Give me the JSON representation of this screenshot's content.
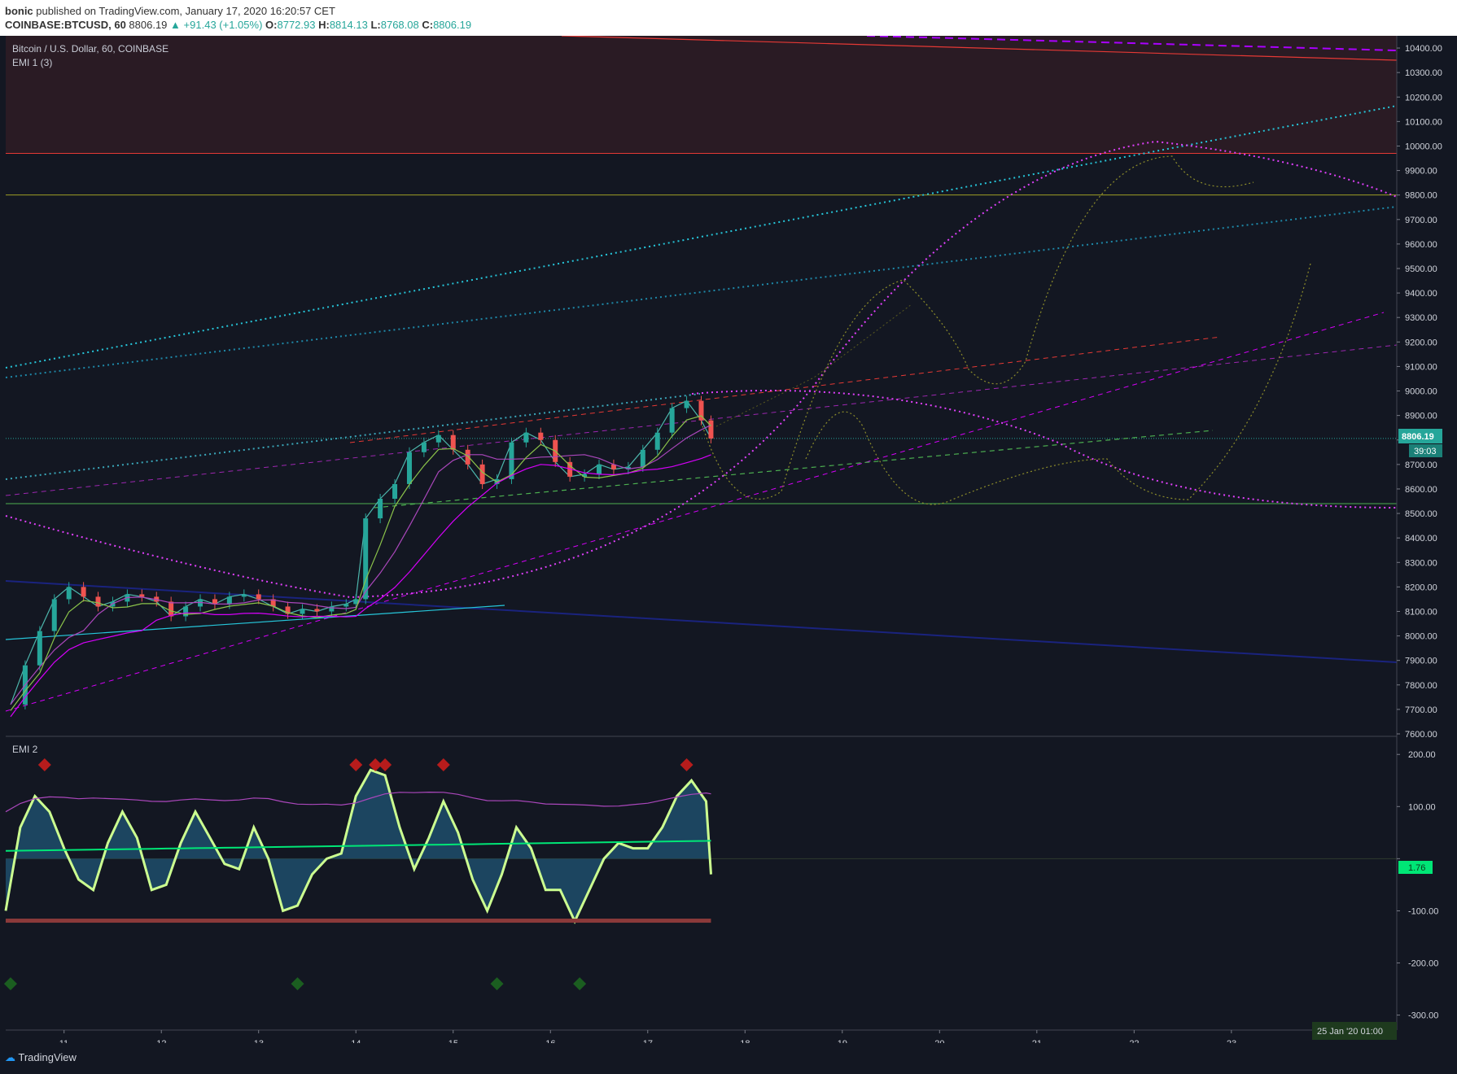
{
  "header": {
    "author": "bonic",
    "published_text": "published on TradingView.com, January 17, 2020 16:20:57 CET",
    "symbol": "COINBASE:BTCUSD, 60",
    "last": "8806.19",
    "change": "+91.43 (+1.05%)",
    "o_label": "O:",
    "o": "8772.93",
    "h_label": "H:",
    "h": "8814.13",
    "l_label": "L:",
    "l": "8768.08",
    "c_label": "C:",
    "c": "8806.19"
  },
  "main_pane": {
    "title": "Bitcoin / U.S. Dollar, 60, COINBASE",
    "indicator": "EMI 1 (3)",
    "price_tag": "8806.19",
    "countdown_tag": "39:03"
  },
  "osc_pane": {
    "title": "EMI 2",
    "value_tag": "1.76"
  },
  "time_axis_tag": "25 Jan '20  01:00",
  "footer": {
    "logo_text": "TradingView"
  },
  "colors": {
    "bg": "#131722",
    "up": "#26a69a",
    "down": "#ef5350",
    "magenta": "#e040fb",
    "cyan": "#26c6da",
    "purple": "#9c27b0",
    "red_line": "#e53935",
    "green_line": "#4caf50",
    "olive": "#8d8d2a"
  },
  "chart_data": [
    {
      "type": "line",
      "title": "Bitcoin / U.S. Dollar, 60, COINBASE",
      "y_ticks": [
        "10400.00",
        "10300.00",
        "10200.00",
        "10100.00",
        "10000.00",
        "9900.00",
        "9800.00",
        "9700.00",
        "9600.00",
        "9500.00",
        "9400.00",
        "9300.00",
        "9200.00",
        "9100.00",
        "9000.00",
        "8900.00",
        "8800.00",
        "8700.00",
        "8600.00",
        "8500.00",
        "8400.00",
        "8300.00",
        "8200.00",
        "8100.00",
        "8000.00",
        "7900.00",
        "7800.00",
        "7700.00",
        "7600.00"
      ],
      "x_ticks": [
        "11",
        "12",
        "13",
        "14",
        "15",
        "16",
        "17",
        "18",
        "19",
        "20",
        "21",
        "22",
        "23"
      ],
      "ylim": [
        7600,
        10450
      ],
      "xlim": [
        10.4,
        24.7
      ],
      "price_close_series": {
        "x": [
          10.45,
          10.6,
          10.75,
          10.9,
          11.05,
          11.2,
          11.35,
          11.5,
          11.65,
          11.8,
          11.95,
          12.1,
          12.25,
          12.4,
          12.55,
          12.7,
          12.85,
          13.0,
          13.15,
          13.3,
          13.45,
          13.6,
          13.75,
          13.9,
          14.0,
          14.1,
          14.25,
          14.4,
          14.55,
          14.7,
          14.85,
          15.0,
          15.15,
          15.3,
          15.45,
          15.6,
          15.75,
          15.9,
          16.05,
          16.2,
          16.35,
          16.5,
          16.65,
          16.8,
          16.95,
          17.1,
          17.25,
          17.4,
          17.55,
          17.65
        ],
        "y": [
          7720,
          7880,
          8020,
          8150,
          8200,
          8160,
          8120,
          8140,
          8170,
          8160,
          8140,
          8080,
          8120,
          8150,
          8130,
          8160,
          8170,
          8150,
          8120,
          8090,
          8110,
          8100,
          8120,
          8130,
          8150,
          8480,
          8560,
          8620,
          8750,
          8790,
          8820,
          8760,
          8700,
          8620,
          8640,
          8790,
          8830,
          8800,
          8710,
          8650,
          8660,
          8700,
          8680,
          8690,
          8760,
          8830,
          8930,
          8960,
          8880,
          8806
        ]
      },
      "horizontal_levels": [
        9970,
        9800,
        8540
      ],
      "resistance_zone": [
        9970,
        10450
      ],
      "current_price": 8806.19
    },
    {
      "type": "line",
      "title": "EMI 2",
      "y_ticks": [
        "200.00",
        "100.00",
        "0",
        "-100.00",
        "-200.00",
        "-300.00"
      ],
      "ylim": [
        -310,
        230
      ],
      "osc_series": {
        "x": [
          10.4,
          10.55,
          10.7,
          10.85,
          11.0,
          11.15,
          11.3,
          11.45,
          11.6,
          11.75,
          11.9,
          12.05,
          12.2,
          12.35,
          12.5,
          12.65,
          12.8,
          12.95,
          13.1,
          13.25,
          13.4,
          13.55,
          13.7,
          13.85,
          14.0,
          14.15,
          14.3,
          14.45,
          14.6,
          14.75,
          14.9,
          15.05,
          15.2,
          15.35,
          15.5,
          15.65,
          15.8,
          15.95,
          16.1,
          16.25,
          16.4,
          16.55,
          16.7,
          16.85,
          17.0,
          17.15,
          17.3,
          17.45,
          17.6,
          17.65
        ],
        "y": [
          -100,
          60,
          120,
          90,
          20,
          -40,
          -60,
          30,
          90,
          40,
          -60,
          -50,
          30,
          90,
          40,
          -10,
          -20,
          60,
          0,
          -100,
          -90,
          -30,
          0,
          10,
          120,
          170,
          160,
          60,
          -20,
          40,
          110,
          50,
          -40,
          -100,
          -30,
          60,
          20,
          -60,
          -60,
          -120,
          -60,
          0,
          30,
          20,
          20,
          60,
          120,
          150,
          110,
          -30
        ]
      },
      "current_value": 1.76
    }
  ]
}
